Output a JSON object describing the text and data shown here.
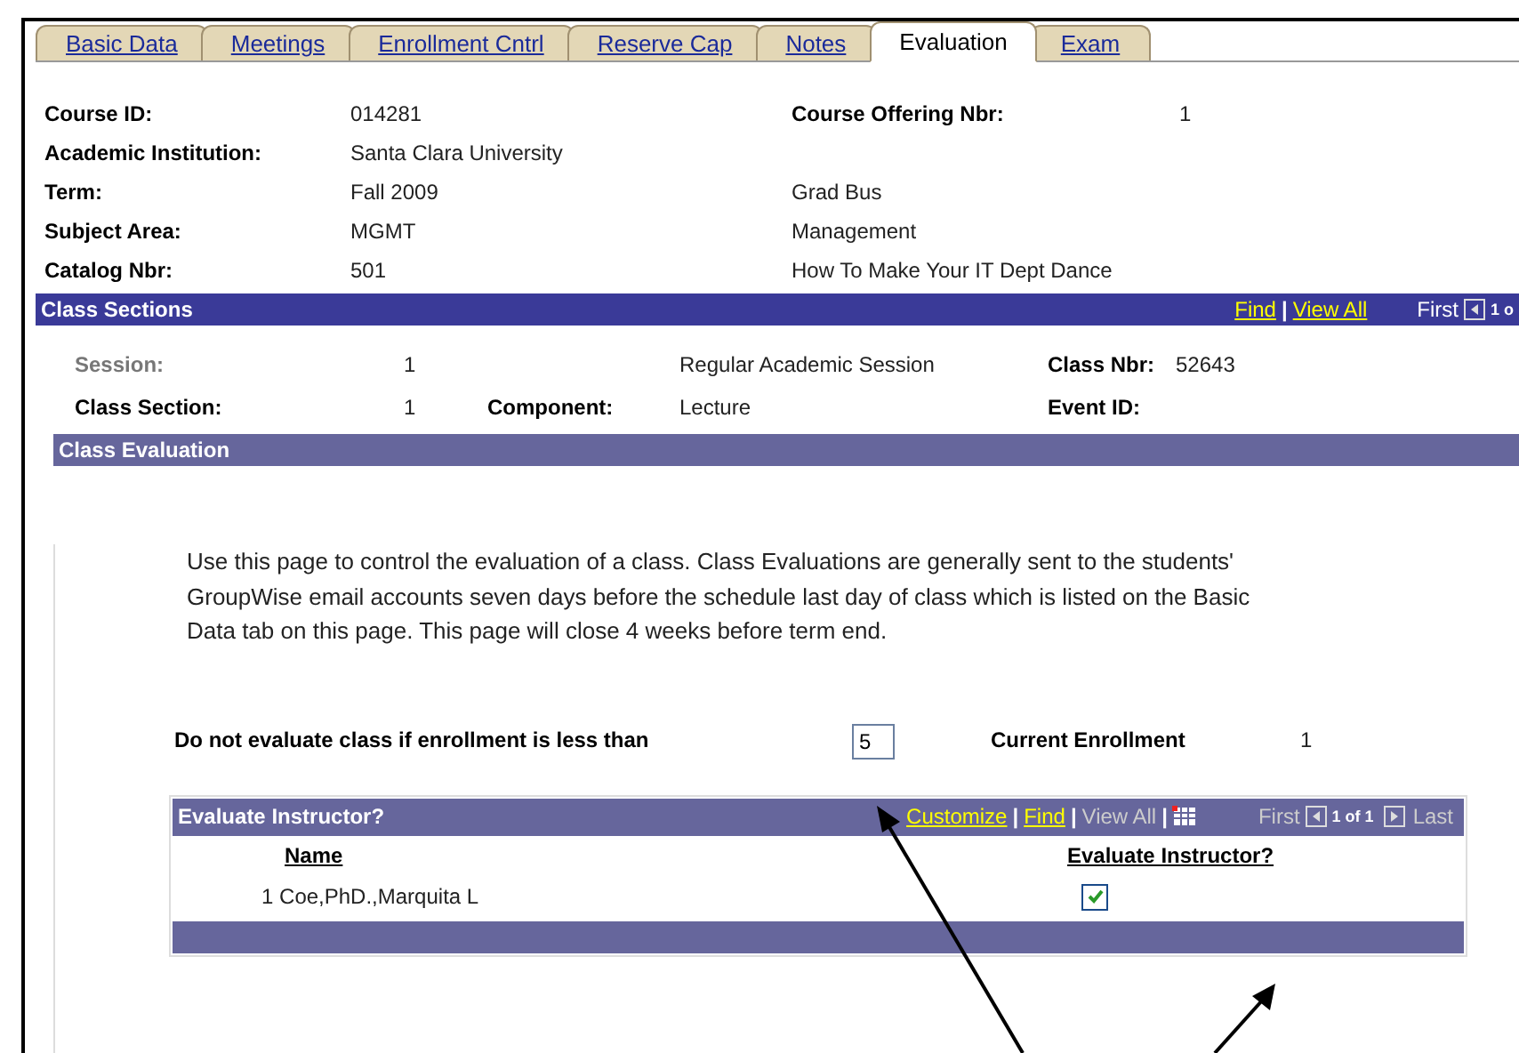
{
  "tabs": [
    {
      "label": "Basic Data",
      "selected": false
    },
    {
      "label": "Meetings",
      "selected": false
    },
    {
      "label": "Enrollment Cntrl",
      "selected": false
    },
    {
      "label": "Reserve Cap",
      "selected": false
    },
    {
      "label": "Notes",
      "selected": false
    },
    {
      "label": "Evaluation",
      "selected": true
    },
    {
      "label": "Exam",
      "selected": false
    }
  ],
  "course": {
    "left": [
      {
        "label": "Course ID:",
        "value": "014281"
      },
      {
        "label": "Academic Institution:",
        "value": "Santa Clara University"
      },
      {
        "label": "Term:",
        "value": "Fall 2009"
      },
      {
        "label": "Subject Area:",
        "value": "MGMT"
      },
      {
        "label": "Catalog Nbr:",
        "value": "501"
      }
    ],
    "right": [
      {
        "label": "Course Offering Nbr:",
        "value": "1"
      },
      {
        "value": "Grad Bus"
      },
      {
        "value": "Management"
      },
      {
        "value": "How To Make Your IT Dept Dance"
      }
    ]
  },
  "class_sections": {
    "title": "Class Sections",
    "links": [
      "Find",
      "View All"
    ],
    "separator": "|",
    "nav": "First",
    "counter": "1 o",
    "session": {
      "label": "Session:",
      "value": "1",
      "description": "Regular Academic Session",
      "class_nbr_label": "Class Nbr:",
      "class_nbr": "52643"
    },
    "section": {
      "label": "Class Section:",
      "value": "1",
      "component_label": "Component:",
      "component": "Lecture",
      "event_label": "Event ID:"
    }
  },
  "class_evaluation": {
    "title": "Class Evaluation",
    "instructions": "Use this page to control the evaluation of a class. Class Evaluations are generally sent to the students' GroupWise email accounts seven days before the schedule last day of class which is listed on the Basic Data tab on this page. This page will close 4 weeks before term end.",
    "threshold": {
      "label": "Do not evaluate class if enrollment is less than",
      "value": "5"
    },
    "current_enrollment": {
      "label": "Current Enrollment",
      "value": "1"
    },
    "grid": {
      "title": "Evaluate Instructor?",
      "links": [
        "Customize",
        "Find"
      ],
      "separators": [
        "|",
        "|",
        "|"
      ],
      "view_all": "View All",
      "first": "First",
      "counter": "1 of 1",
      "last": "Last",
      "columns": [
        "Name",
        "Evaluate Instructor?"
      ],
      "rows": [
        {
          "number": "1",
          "name": "Coe,PhD.,Marquita L",
          "checked": true
        }
      ]
    }
  }
}
